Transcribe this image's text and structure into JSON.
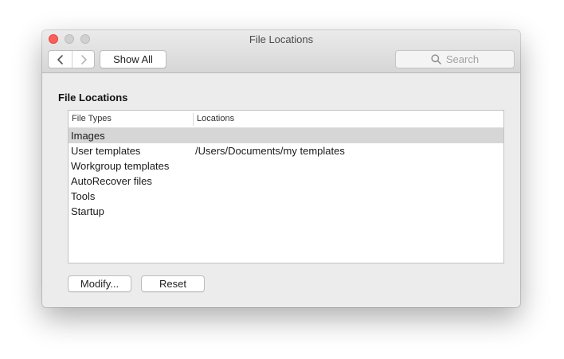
{
  "window": {
    "title": "File Locations"
  },
  "toolbar": {
    "back_icon": "chevron-left-icon",
    "forward_icon": "chevron-right-icon",
    "show_all_label": "Show All",
    "search_placeholder": "Search",
    "search_icon": "search-icon"
  },
  "section": {
    "heading": "File Locations"
  },
  "table": {
    "columns": [
      "File Types",
      "Locations"
    ],
    "rows": [
      {
        "type": "Images",
        "location": "",
        "selected": true
      },
      {
        "type": "User templates",
        "location": "/Users/Documents/my templates",
        "selected": false
      },
      {
        "type": "Workgroup templates",
        "location": "",
        "selected": false
      },
      {
        "type": "AutoRecover files",
        "location": "",
        "selected": false
      },
      {
        "type": "Tools",
        "location": "",
        "selected": false
      },
      {
        "type": "Startup",
        "location": "",
        "selected": false
      }
    ]
  },
  "buttons": {
    "modify_label": "Modify...",
    "reset_label": "Reset"
  },
  "colors": {
    "close": "#fc5f57",
    "inactive_traffic": "#d0d0d0",
    "selected_row": "#d6d6d6"
  }
}
